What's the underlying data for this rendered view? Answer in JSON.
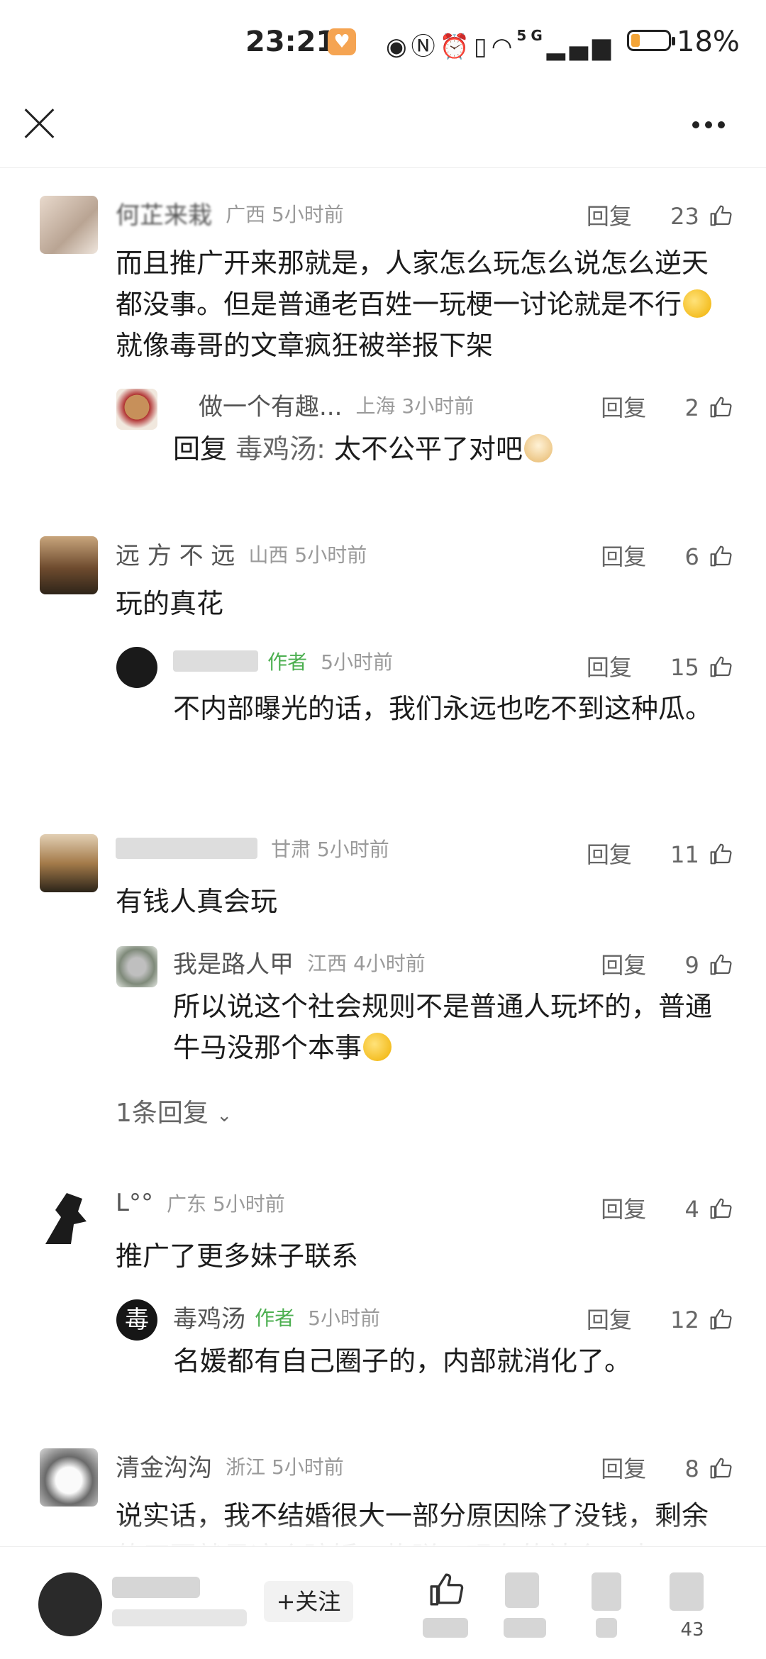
{
  "status_bar": {
    "time": "23:21",
    "battery": "18%",
    "network": "5G"
  },
  "comments": [
    {
      "name": "何芷来栽",
      "location": "广西 5小时前",
      "reply_label": "回复",
      "likes": "23",
      "text_a": "而且推广开来那就是，人家怎么玩怎么说怎么逆天都没事。但是普通老百姓一玩梗一讨论就是不行",
      "text_b": "就像毒哥的文章疯狂被举报下架",
      "replies": [
        {
          "name": "做一个有趣...",
          "location": "上海 3小时前",
          "reply_label": "回复",
          "likes": "2",
          "prefix": "回复 ",
          "mention": "毒鸡汤: ",
          "text": "太不公平了对吧"
        }
      ]
    },
    {
      "name": "远 方 不 远",
      "location": "山西 5小时前",
      "reply_label": "回复",
      "likes": "6",
      "text": "玩的真花",
      "replies": [
        {
          "author_tag": "作者",
          "location": "5小时前",
          "reply_label": "回复",
          "likes": "15",
          "text": "不内部曝光的话，我们永远也吃不到这种瓜。"
        }
      ]
    },
    {
      "location": "甘肃 5小时前",
      "reply_label": "回复",
      "likes": "11",
      "text": "有钱人真会玩",
      "replies": [
        {
          "name": "我是路人甲",
          "location": "江西 4小时前",
          "reply_label": "回复",
          "likes": "9",
          "text": "所以说这个社会规则不是普通人玩坏的，普通牛马没那个本事"
        }
      ],
      "more_replies": "1条回复"
    },
    {
      "name": "L°°",
      "location": "广东 5小时前",
      "reply_label": "回复",
      "likes": "4",
      "text": "推广了更多妹子联系",
      "replies": [
        {
          "name": "毒鸡汤",
          "author_tag": "作者",
          "location": "5小时前",
          "reply_label": "回复",
          "likes": "12",
          "text": "名媛都有自己圈子的，内部就消化了。",
          "avatar_char": "毒"
        }
      ]
    },
    {
      "name": "清金沟沟",
      "location": "浙江 5小时前",
      "reply_label": "回复",
      "likes": "8",
      "text": "说实话，我不结婚很大一部分原因除了没钱，剩余的原因就是这个骗婚，炸弹，现在的社会，大"
    }
  ],
  "bottom_bar": {
    "follow_label": "+关注",
    "count_last": "43"
  },
  "colors": {
    "author_green": "#4caf50",
    "meta_gray": "#9a9a9a",
    "text": "#1c1c1c"
  }
}
